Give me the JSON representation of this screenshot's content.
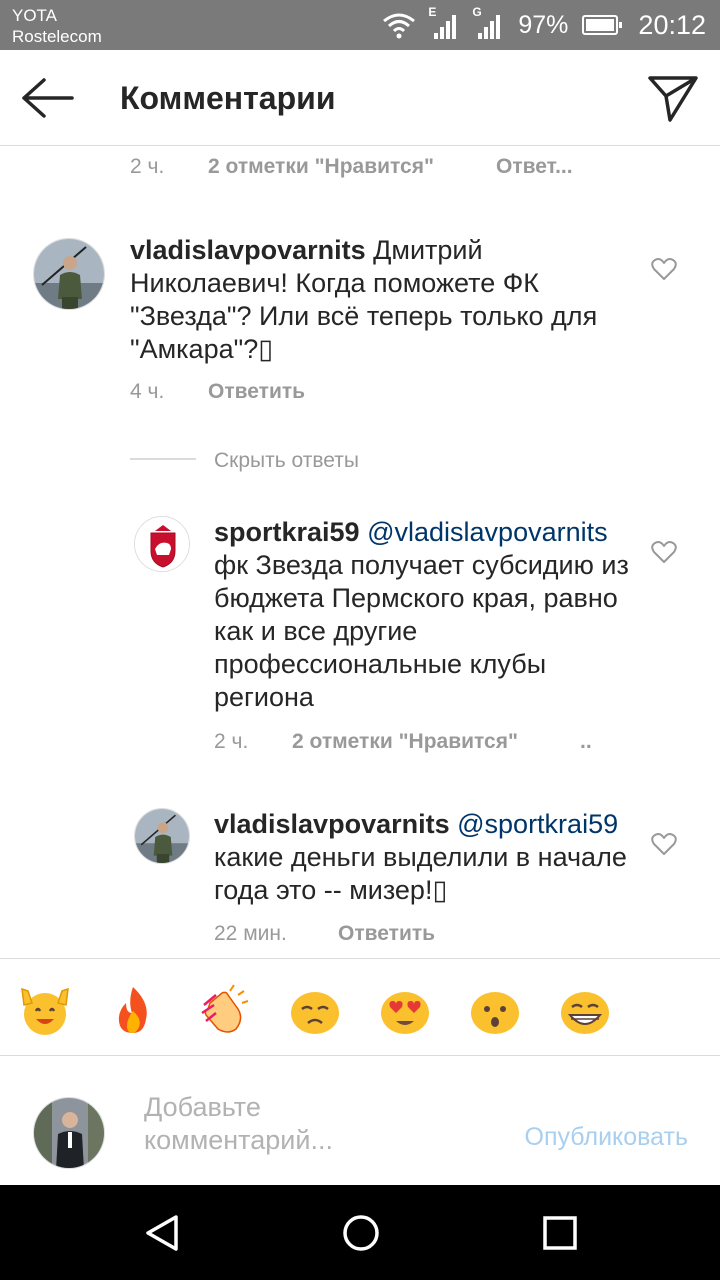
{
  "status_bar": {
    "carrier_line1": "YOTA",
    "carrier_line2": "Rostelecom",
    "net1": "E",
    "net2": "G",
    "battery_pct": "97%",
    "battery_level": 0.97,
    "time": "20:12"
  },
  "header": {
    "title": "Комментарии",
    "back_icon": "arrow-left-icon",
    "send_icon": "paper-plane-icon"
  },
  "top_meta": {
    "time": "2 ч.",
    "likes": "2 отметки \"Нравится\"",
    "reply": "Ответ..."
  },
  "comments": [
    {
      "username": "vladislavpovarnits",
      "text": " Дмитрий Николаевич! Когда поможете ФК \"Звезда\"? Или всё теперь только для \"Амкара\"?",
      "emoji_box": "▯",
      "time": "4 ч.",
      "reply": "Ответить"
    }
  ],
  "hide_replies": "Скрыть ответы",
  "replies": [
    {
      "username": "sportkrai59",
      "mention": "@vladislavpovarnits",
      "text": "фк Звезда получает субсидию из бюджета Пермского края, равно как и все другие профессиональные клубы региона",
      "time": "2 ч.",
      "likes": "2 отметки \"Нравится\"",
      "more": ".."
    },
    {
      "username": "vladislavpovarnits",
      "mention": "@sportkrai59",
      "text": "какие деньги выделили в начале года это -- мизер!",
      "emoji_box": "▯",
      "time": "22 мин.",
      "reply": "Ответить"
    }
  ],
  "emoji_bar": [
    "raising-hands-emoji",
    "fire-emoji",
    "clapping-hands-emoji",
    "sad-face-emoji",
    "heart-eyes-emoji",
    "surprised-face-emoji",
    "grinning-face-emoji"
  ],
  "input": {
    "placeholder": "Добавьте комментарий...",
    "publish": "Опубликовать"
  },
  "colors": {
    "status_bar_bg": "#7a7a7a",
    "mention": "#003569",
    "muted": "#999999",
    "publish_disabled": "#a8cff0"
  }
}
